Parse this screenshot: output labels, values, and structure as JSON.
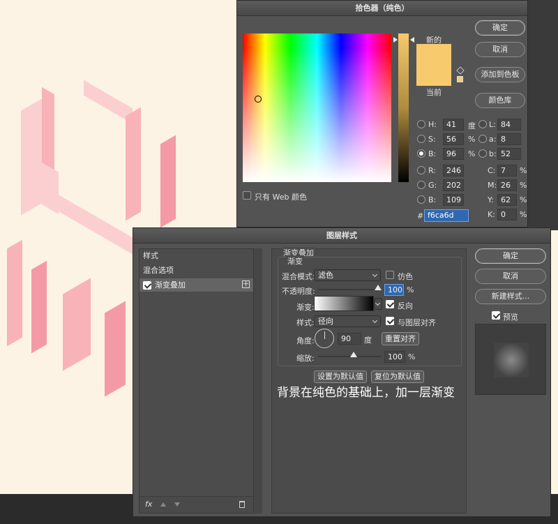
{
  "color_picker": {
    "title": "拾色器（纯色）",
    "new_label": "新的",
    "current_label": "当前",
    "new_color": "#f6ca6d",
    "current_color": "#f6ca6d",
    "web_only_label": "只有 Web 颜色",
    "buttons": {
      "ok": "确定",
      "cancel": "取消",
      "add_swatch": "添加到色板",
      "libraries": "颜色库"
    },
    "hsb": [
      {
        "label": "H:",
        "value": "41",
        "unit": "度"
      },
      {
        "label": "S:",
        "value": "56",
        "unit": "%"
      },
      {
        "label": "B:",
        "value": "96",
        "unit": "%"
      }
    ],
    "rgb": [
      {
        "label": "R:",
        "value": "246"
      },
      {
        "label": "G:",
        "value": "202"
      },
      {
        "label": "B:",
        "value": "109"
      }
    ],
    "lab": [
      {
        "label": "L:",
        "value": "84"
      },
      {
        "label": "a:",
        "value": "8"
      },
      {
        "label": "b:",
        "value": "52"
      }
    ],
    "cmyk": [
      {
        "label": "C:",
        "value": "7",
        "unit": "%"
      },
      {
        "label": "M:",
        "value": "26",
        "unit": "%"
      },
      {
        "label": "Y:",
        "value": "62",
        "unit": "%"
      },
      {
        "label": "K:",
        "value": "0",
        "unit": "%"
      }
    ],
    "hex_label": "#",
    "hex_value": "f6ca6d"
  },
  "layer_style": {
    "title": "图层样式",
    "sidebar": [
      "样式",
      "混合选项",
      "渐变叠加"
    ],
    "section_title": "渐变叠加",
    "subsection_title": "渐变",
    "blend_mode_label": "混合模式:",
    "blend_mode_value": "滤色",
    "dither_label": "仿色",
    "opacity_label": "不透明度:",
    "opacity_value": "100",
    "percent": "%",
    "gradient_label": "渐变:",
    "reverse_label": "反向",
    "style_label": "样式:",
    "style_value": "径向",
    "align_label": "与图层对齐",
    "angle_label": "角度:",
    "angle_value": "90",
    "angle_unit": "度",
    "reset_align": "重置对齐",
    "scale_label": "缩放:",
    "scale_value": "100",
    "make_default": "设置为默认值",
    "reset_default": "复位为默认值",
    "buttons": {
      "ok": "确定",
      "cancel": "取消",
      "new_style": "新建样式...",
      "preview": "预览"
    },
    "fx_label": "fx"
  },
  "caption": "背景在纯色的基础上，加一层渐变"
}
